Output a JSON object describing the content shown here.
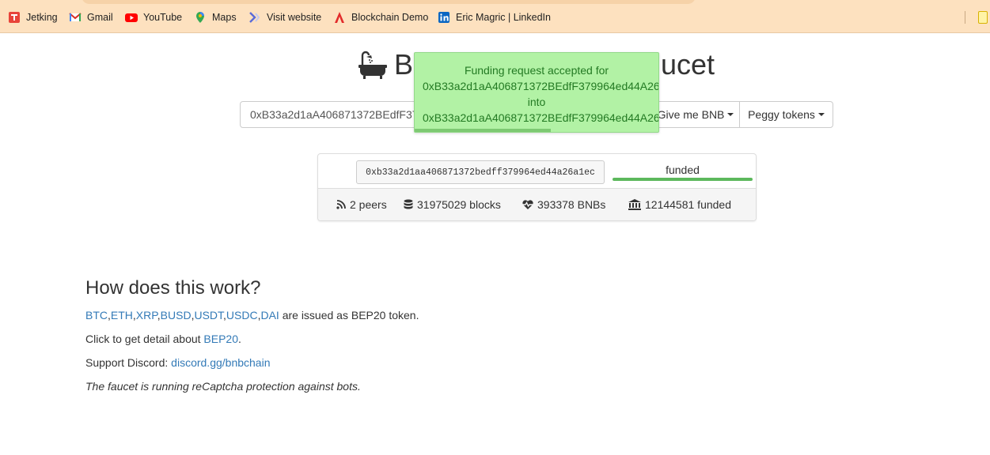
{
  "bookmarks": [
    {
      "label": "Jetking",
      "icon": "jetking-icon"
    },
    {
      "label": "Gmail",
      "icon": "gmail-icon"
    },
    {
      "label": "YouTube",
      "icon": "youtube-icon"
    },
    {
      "label": "Maps",
      "icon": "maps-icon"
    },
    {
      "label": "Visit website",
      "icon": "visit-website-icon"
    },
    {
      "label": "Blockchain Demo",
      "icon": "blockchain-demo-icon"
    },
    {
      "label": "Eric Magric | LinkedIn",
      "icon": "linkedin-icon"
    }
  ],
  "header": {
    "title_left": "B",
    "title_right": "ucet",
    "icon": "bathtub-icon"
  },
  "form": {
    "address_value": "0xB33a2d1aA406871372BEdfF379964ed44A26a1ec",
    "bnb_button": "Give me BNB",
    "peggy_button": "Peggy tokens"
  },
  "notification": {
    "line1": "Funding request accepted for",
    "address1": "0xB33a2d1aA406871372BEdfF379964ed44A26",
    "line2": "into",
    "address2": "0xB33a2d1aA406871372BEdfF379964ed44A26",
    "progress": 0.56
  },
  "request": {
    "address": "0xb33a2d1aa406871372bedff379964ed44a26a1ec",
    "status": "funded",
    "progress": 1.0
  },
  "stats": {
    "peers": "2 peers",
    "blocks": "31975029 blocks",
    "bnbs": "393378 BNBs",
    "funded": "12144581 funded"
  },
  "how": {
    "title": "How does this work?",
    "tokens": [
      "BTC",
      "ETH",
      "XRP",
      "BUSD",
      "USDT",
      "USDC",
      "DAI"
    ],
    "tokens_suffix": " are issued as BEP20 token.",
    "detail_prefix": "Click to get detail about ",
    "detail_link": "BEP20",
    "detail_suffix": ".",
    "discord_prefix": "Support Discord: ",
    "discord_link": "discord.gg/bnbchain",
    "captcha_note": "The faucet is running reCaptcha protection against bots."
  },
  "colors": {
    "bookmarks_bg": "#fde1bf",
    "notice_bg": "#b2f2a5",
    "notice_text": "#237a23",
    "link": "#337ab7",
    "success_bar": "#5cb85c"
  }
}
